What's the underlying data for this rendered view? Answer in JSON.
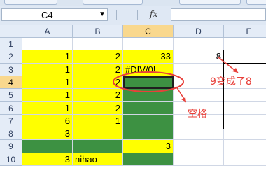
{
  "formula_bar": {
    "name_box": "C4",
    "fx_label": "fx",
    "formula": ""
  },
  "columns": [
    "A",
    "B",
    "C",
    "D",
    "E"
  ],
  "rows": [
    "1",
    "2",
    "3",
    "4",
    "5",
    "6",
    "7",
    "8",
    "9",
    "10"
  ],
  "cells": {
    "A2": "1",
    "B2": "2",
    "C2": "33",
    "D2": "8",
    "A3": "1",
    "B3": "2",
    "C3": "#DIV/0!",
    "A4": "1",
    "B4": "2",
    "C4": "",
    "A5": "1",
    "B5": "2",
    "A6": "1",
    "B6": "2",
    "A7": "6",
    "B7": "1",
    "A8": "3",
    "C9": "3",
    "A10": "3",
    "B10": "nihao"
  },
  "annotations": {
    "nine_became_eight": "9变成了8",
    "blank": "空格"
  },
  "colors": {
    "yellow_fill": "#ffff00",
    "green_fill": "#3d9142",
    "annotation_red": "#e8403a",
    "selected_header": "#f9d88e"
  }
}
